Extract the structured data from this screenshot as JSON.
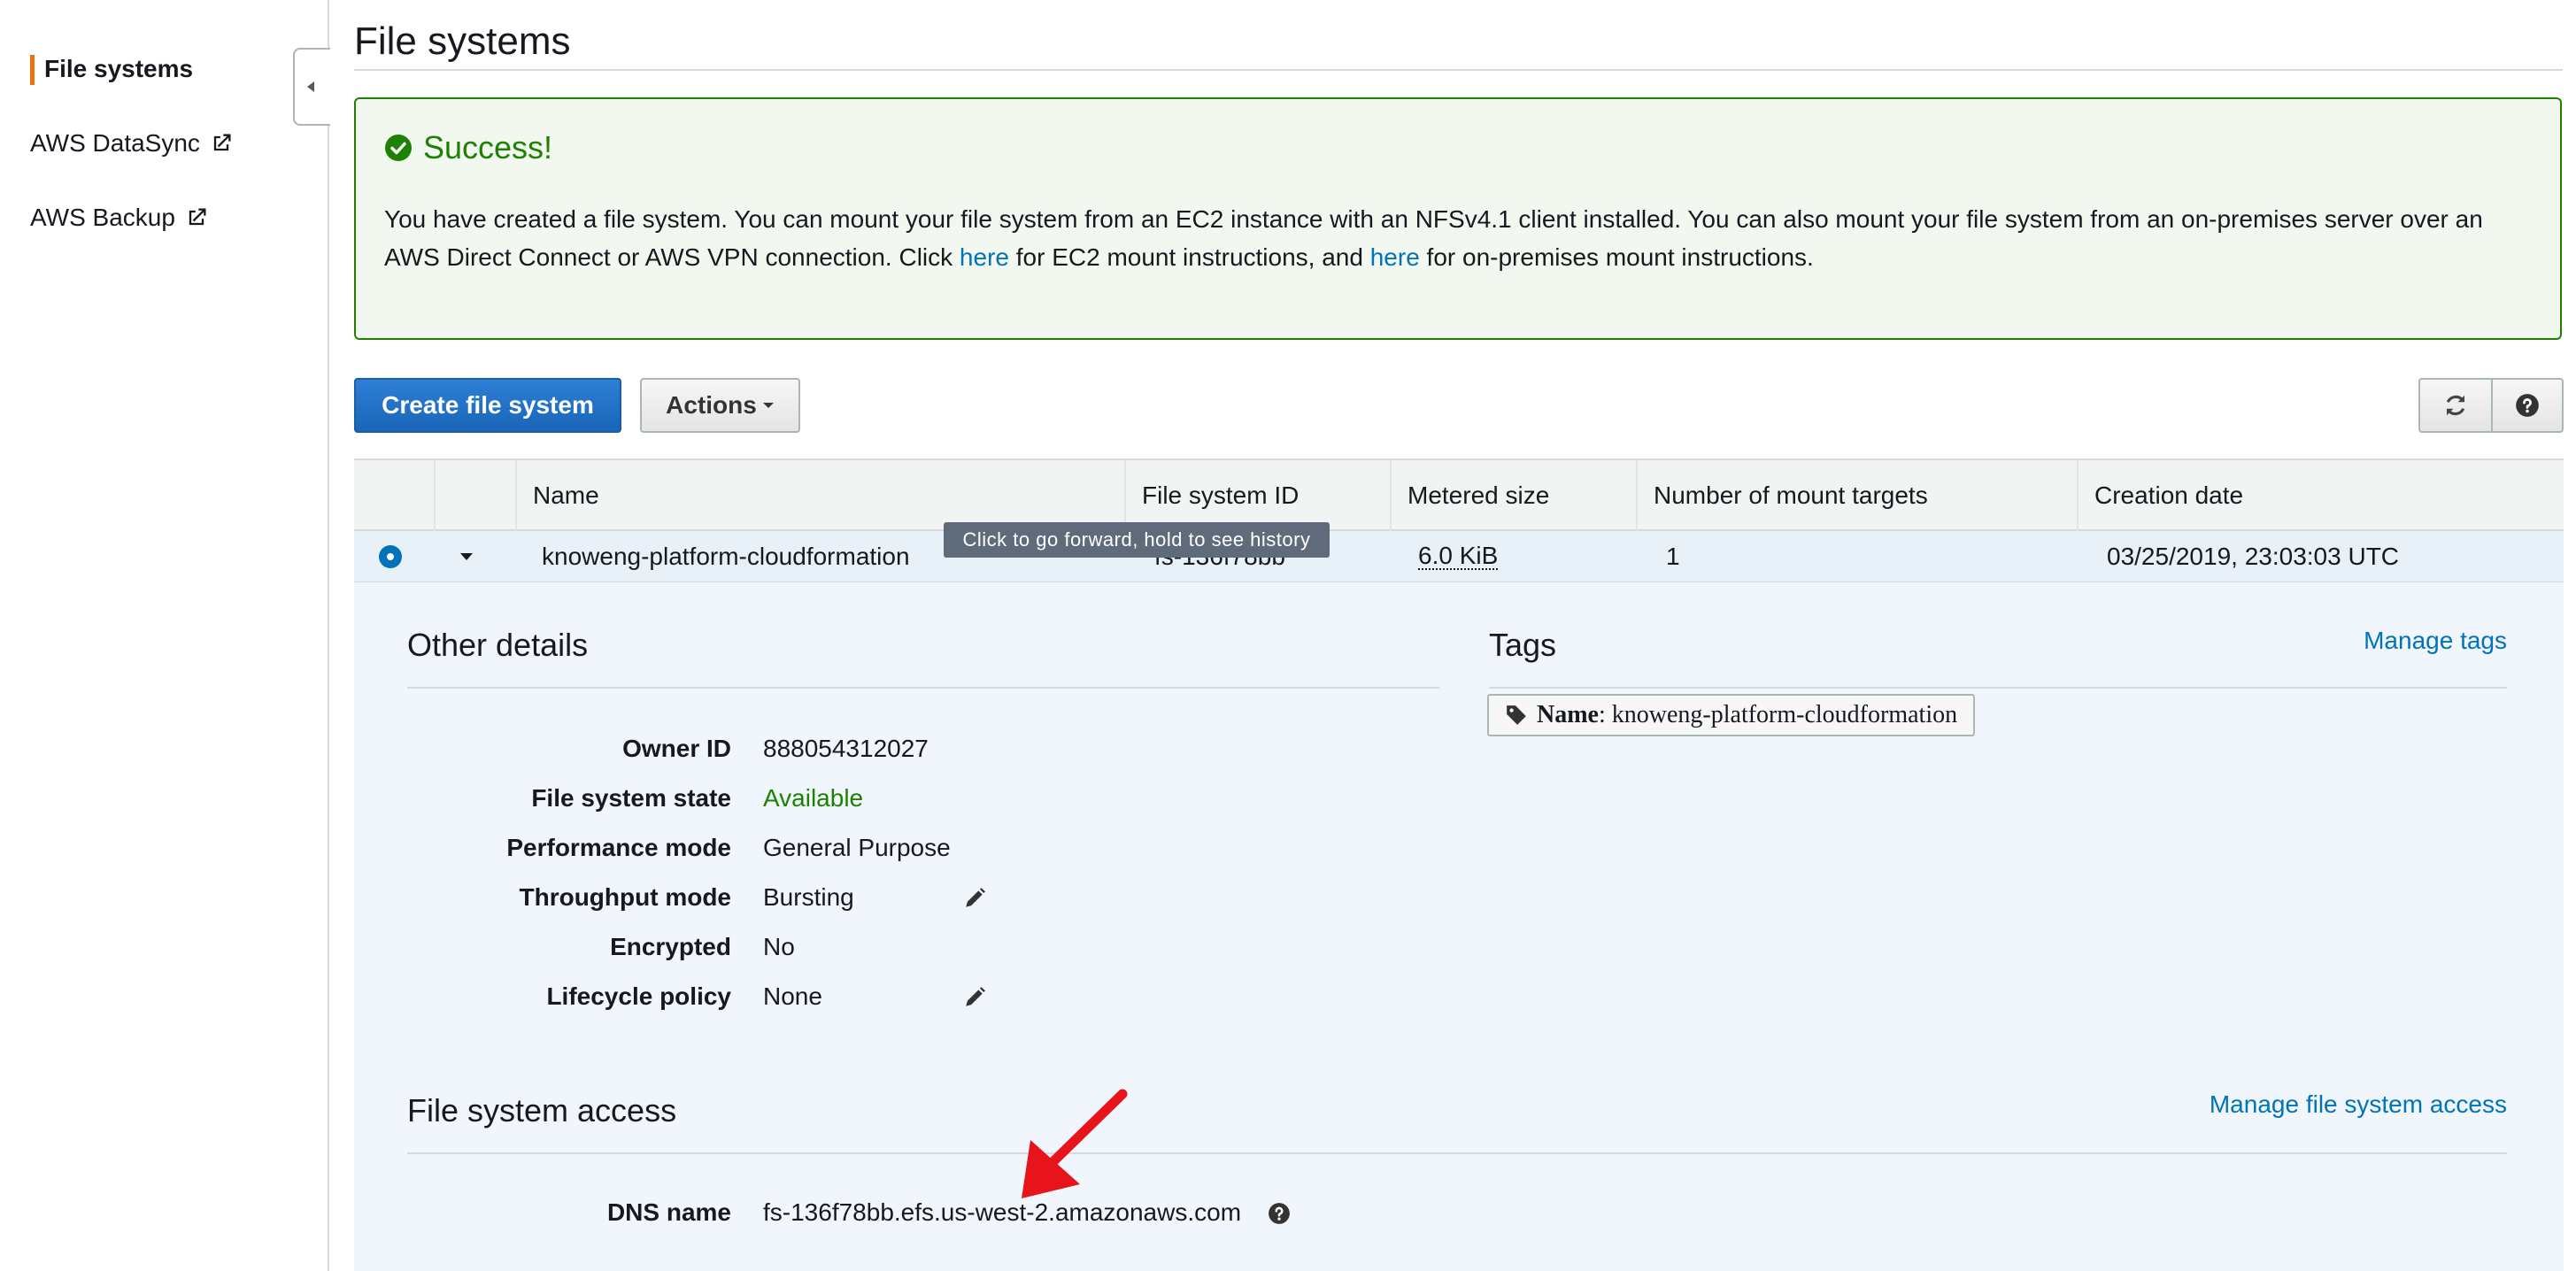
{
  "sidebar": {
    "items": [
      {
        "label": "File systems",
        "active": true
      },
      {
        "label": "AWS DataSync",
        "external": true
      },
      {
        "label": "AWS Backup",
        "external": true
      }
    ]
  },
  "page": {
    "title": "File systems"
  },
  "alert": {
    "title": "Success!",
    "message_pre": "You have created a file system. You can mount your file system from an EC2 instance with an NFSv4.1 client installed. You can also mount your file system from an on-premises server over an AWS Direct Connect or AWS VPN connection. Click ",
    "link1": "here",
    "message_mid": " for EC2 mount instructions, and ",
    "link2": "here",
    "message_post": " for on-premises mount instructions."
  },
  "toolbar": {
    "create_label": "Create file system",
    "actions_label": "Actions",
    "refresh_icon": "refresh-icon",
    "help_icon": "help-icon"
  },
  "table": {
    "columns": [
      "Name",
      "File system ID",
      "Metered size",
      "Number of mount targets",
      "Creation date"
    ],
    "row": {
      "name": "knoweng-platform-cloudformation",
      "fs_id": "fs-136f78bb",
      "metered_size": "6.0 KiB",
      "mount_targets": "1",
      "creation_date": "03/25/2019, 23:03:03 UTC"
    }
  },
  "tooltip": "Click to go forward, hold to see history",
  "other_details": {
    "title": "Other details",
    "rows": [
      {
        "label": "Owner ID",
        "value": "888054312027"
      },
      {
        "label": "File system state",
        "value": "Available"
      },
      {
        "label": "Performance mode",
        "value": "General Purpose"
      },
      {
        "label": "Throughput mode",
        "value": "Bursting"
      },
      {
        "label": "Encrypted",
        "value": "No"
      },
      {
        "label": "Lifecycle policy",
        "value": "None"
      }
    ]
  },
  "tags": {
    "title": "Tags",
    "manage_label": "Manage tags",
    "chip_key": "Name",
    "chip_value": ": knoweng-platform-cloudformation"
  },
  "access": {
    "title": "File system access",
    "manage_label": "Manage file system access",
    "dns_label": "DNS name",
    "dns_value": "fs-136f78bb.efs.us-west-2.amazonaws.com"
  },
  "colors": {
    "success": "#1d8102",
    "link": "#0073bb",
    "primary": "#1966b8",
    "active_nav": "#ec7211",
    "annotation_arrow": "#e8141c"
  }
}
